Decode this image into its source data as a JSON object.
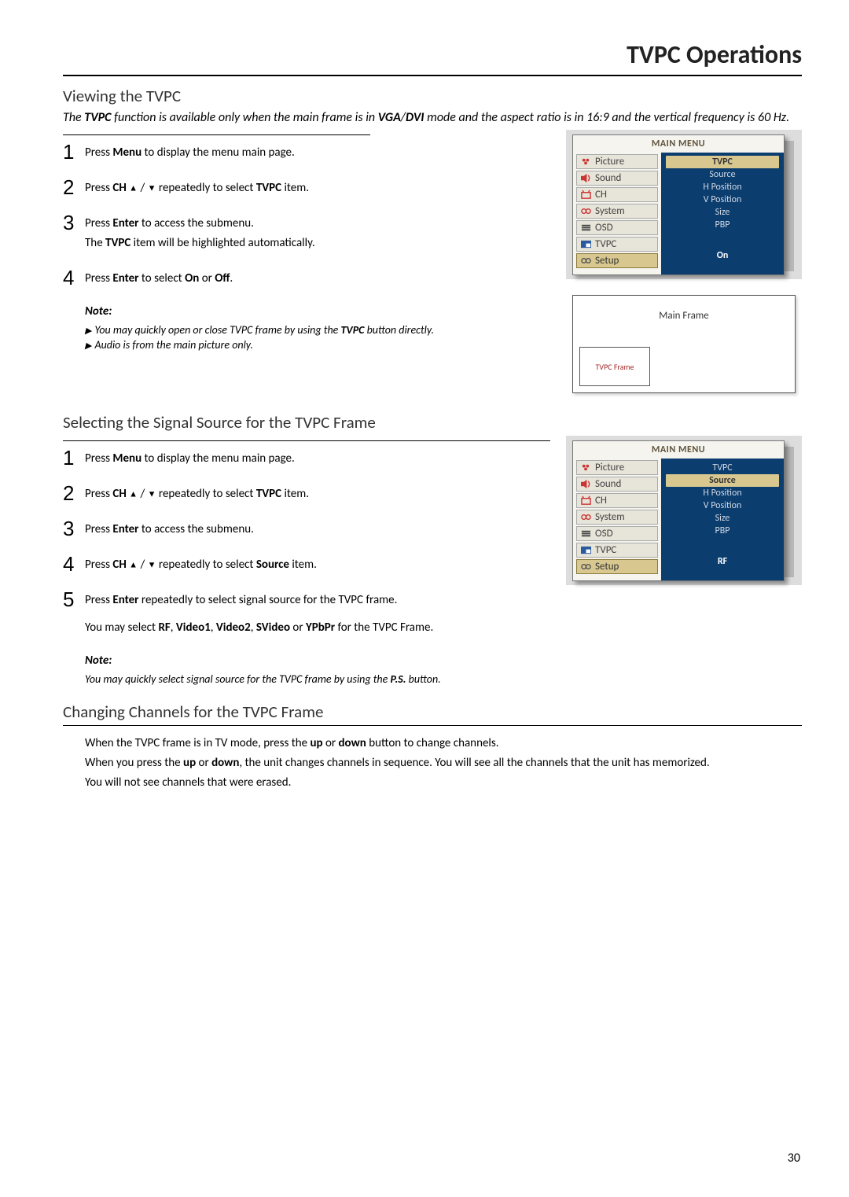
{
  "header": {
    "title": "TVPC Operations"
  },
  "page_number": "30",
  "s1": {
    "title": "Viewing the TVPC",
    "intro_pre": "The ",
    "intro_b1": "TVPC",
    "intro_mid": " function is available only when the main frame is in ",
    "intro_b2": "VGA",
    "intro_slash": "/",
    "intro_b3": "DVI",
    "intro_post": " mode and the aspect ratio is in 16:9 and the vertical frequency is 60 Hz.",
    "steps": {
      "n1": "1",
      "n2": "2",
      "n3": "3",
      "n4": "4",
      "t1_pre": "Press ",
      "t1_b": "Menu ",
      "t1_post": "to display the menu main page.",
      "t2_pre": "Press ",
      "t2_b1": "CH ",
      "t2_mid": " repeatedly to select ",
      "t2_b2": "TVPC",
      "t2_post": " item.",
      "t3a_pre": "Press ",
      "t3a_b": "Enter",
      "t3a_post": " to access the submenu.",
      "t3b_pre": "The ",
      "t3b_b": "TVPC",
      "t3b_post": "  item will be highlighted automatically.",
      "t4_pre": "Press ",
      "t4_b1": "Enter",
      "t4_mid": " to select ",
      "t4_b2": "On",
      "t4_or": " or ",
      "t4_b3": "Off",
      "t4_post": "."
    },
    "note": {
      "title": "Note:",
      "l1_pre": "You may quickly open or close TVPC  frame by using the ",
      "l1_b": "TVPC",
      "l1_post": " button directly.",
      "l2": "Audio is from the main picture only."
    }
  },
  "osd1": {
    "title": "MAIN MENU",
    "left": [
      "Picture",
      "Sound",
      "CH",
      "System",
      "OSD",
      "TVPC",
      "Setup"
    ],
    "right": [
      "TVPC",
      "Source",
      "H Position",
      "V Position",
      "Size",
      "PBP"
    ],
    "footer": "On"
  },
  "frame": {
    "main": "Main Frame",
    "tvpc": "TVPC Frame"
  },
  "s2": {
    "title": "Selecting the Signal Source for the TVPC Frame",
    "steps": {
      "n1": "1",
      "n2": "2",
      "n3": "3",
      "n4": "4",
      "n5": "5",
      "t1_pre": "Press ",
      "t1_b": "Menu ",
      "t1_post": "to display the menu main page.",
      "t2_pre": "Press ",
      "t2_b1": "CH ",
      "t2_mid": " repeatedly to select ",
      "t2_b2": "TVPC",
      "t2_post": " item.",
      "t3_pre": "Press ",
      "t3_b": "Enter",
      "t3_post": " to access the submenu.",
      "t4_pre": "Press ",
      "t4_b1": "CH ",
      "t4_mid": " repeatedly to select ",
      "t4_b2": "Source",
      "t4_post": " item.",
      "t5_pre": "Press ",
      "t5_b": "Enter",
      "t5_post": " repeatedly to select signal source for the TVPC frame.",
      "t5b_pre": "You may select ",
      "t5b_b1": "RF",
      "t5b_c1": ", ",
      "t5b_b2": "Video1",
      "t5b_c2": ", ",
      "t5b_b3": "Video2",
      "t5b_c3": ", ",
      "t5b_b4": "SVideo",
      "t5b_or": " or ",
      "t5b_b5": "YPbPr",
      "t5b_post": " for the TVPC Frame."
    },
    "note": {
      "title": "Note:",
      "l1_pre": "You may quickly select signal source for the TVPC frame by using the ",
      "l1_b": "P.S.",
      "l1_post": " button."
    }
  },
  "osd2": {
    "title": "MAIN MENU",
    "left": [
      "Picture",
      "Sound",
      "CH",
      "System",
      "OSD",
      "TVPC",
      "Setup"
    ],
    "right": [
      "TVPC",
      "Source",
      "H Position",
      "V Position",
      "Size",
      "PBP"
    ],
    "footer": "RF"
  },
  "s3": {
    "title": "Changing Channels for the TVPC Frame",
    "p1_pre": "When the TVPC frame is in TV mode, press the ",
    "p1_b1": "up",
    "p1_or": " or ",
    "p1_b2": "down",
    "p1_post": " button to change channels.",
    "p2_pre": "When you press the ",
    "p2_b1": "up",
    "p2_or": " or ",
    "p2_b2": "down",
    "p2_post": ", the unit changes channels in sequence. You will see all the channels that the unit has memorized.",
    "p3": "You will not see channels that were erased."
  }
}
